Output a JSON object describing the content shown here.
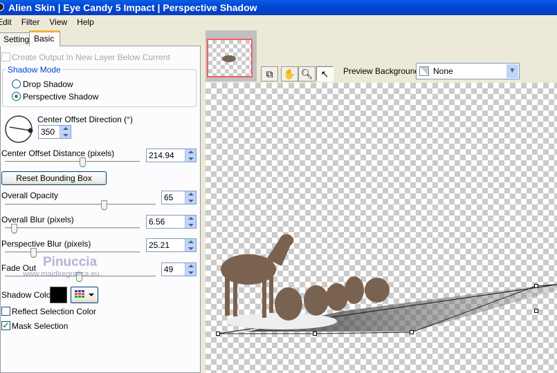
{
  "title": "Alien Skin | Eye Candy 5 Impact | Perspective Shadow",
  "menu": [
    "Edit",
    "Filter",
    "View",
    "Help"
  ],
  "tabs": [
    "Settings",
    "Basic"
  ],
  "basic": {
    "create_output": "Create Output In New Layer Below Current",
    "shadow_mode": {
      "label": "Shadow Mode",
      "options": [
        "Drop Shadow",
        "Perspective Shadow"
      ],
      "selected": "Perspective Shadow"
    },
    "direction": {
      "label": "Center Offset Direction (°)",
      "value": "350"
    },
    "distance": {
      "label": "Center Offset Distance (pixels)",
      "value": "214.94",
      "slider": 0.58
    },
    "reset_button": "Reset Bounding Box",
    "opacity": {
      "label": "Overall Opacity",
      "value": "65",
      "slider": 0.65
    },
    "blur": {
      "label": "Overall Blur (pixels)",
      "value": "6.56",
      "slider": 0.07
    },
    "persp_blur": {
      "label": "Perspective Blur (pixels)",
      "value": "25.21",
      "slider": 0.2
    },
    "fade_out": {
      "label": "Fade Out",
      "value": "49",
      "slider": 0.49
    },
    "shadow_color": {
      "label": "Shadow Color",
      "color": "#000000"
    },
    "reflect": {
      "label": "Reflect Selection Color",
      "checked": false
    },
    "mask": {
      "label": "Mask Selection",
      "checked": true
    }
  },
  "watermark": {
    "name": "Pinuccia",
    "url": "www.maidiregrafica.eu"
  },
  "preview": {
    "bg_label": "Preview Background:",
    "bg_value": "None"
  }
}
